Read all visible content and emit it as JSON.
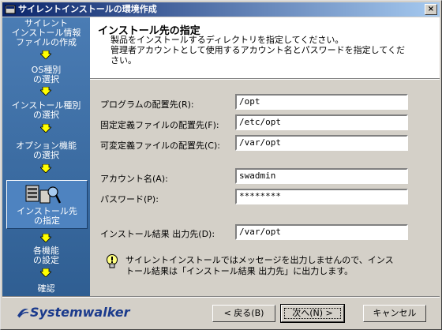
{
  "window": {
    "title": "サイレントインストールの環境作成"
  },
  "sidebar": {
    "steps": [
      "サイレント\nインストール情報\nファイルの作成",
      "OS種別\nの選択",
      "インストール種別\nの選択",
      "オプション機能\nの選択",
      "インストール先\nの指定",
      "各機能\nの設定",
      "確認"
    ]
  },
  "header": {
    "title": "インストール先の指定",
    "desc": "製品をインストールするディレクトリを指定してください。\n管理者アカウントとして使用するアカウント名とパスワードを指定してくだ\nさい。"
  },
  "form": {
    "program_label": "プログラムの配置先(R):",
    "program_value": "/opt",
    "fixed_label": "固定定義ファイルの配置先(F):",
    "fixed_value": "/etc/opt",
    "var_label": "可変定義ファイルの配置先(C):",
    "var_value": "/var/opt",
    "account_label": "アカウント名(A):",
    "account_value": "swadmin",
    "password_label": "パスワード(P):",
    "password_value": "********",
    "result_label": "インストール結果 出力先(D):",
    "result_value": "/var/opt"
  },
  "info": {
    "text": "サイレントインストールではメッセージを出力しませんので、インス\nトール結果は「インストール結果 出力先」に出力します。"
  },
  "footer": {
    "logo": "Systemwalker",
    "back": "< 戻る(B)",
    "next": "次へ(N) >",
    "cancel": "キャンセル"
  },
  "colors": {
    "sidebar": "#3a6ea5",
    "title_start": "#0a246a",
    "title_end": "#a6caf0",
    "arrow": "#ffff00"
  }
}
